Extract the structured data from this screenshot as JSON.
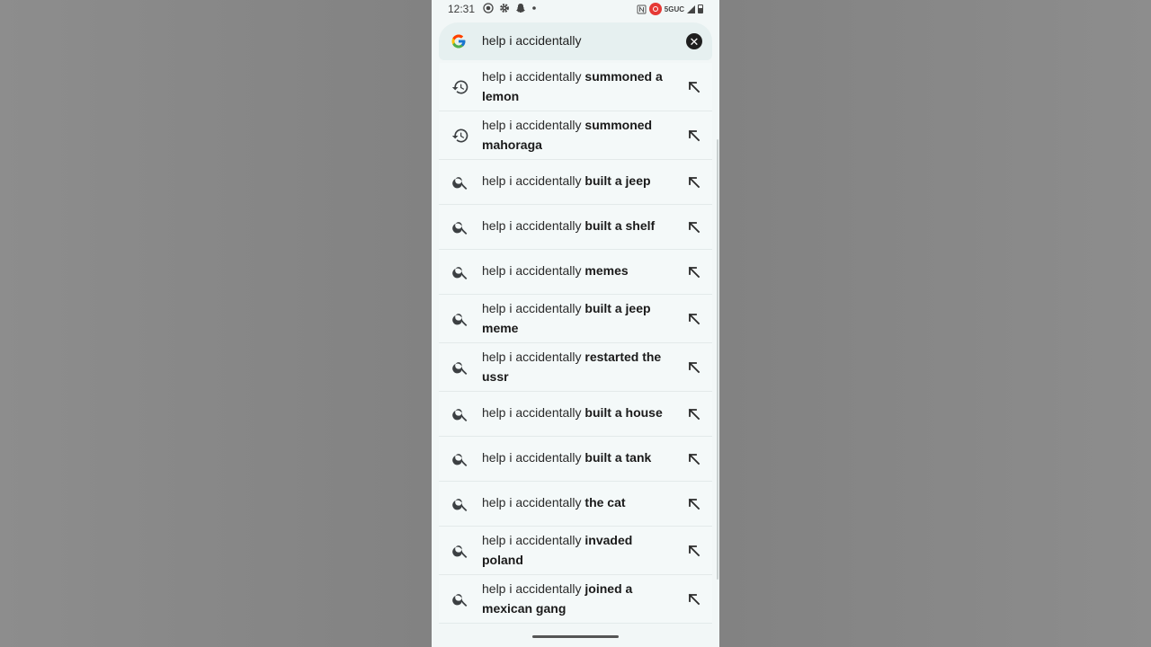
{
  "status_bar": {
    "time": "12:31",
    "left_icons": [
      "record-icon",
      "gear-icon",
      "snapchat-icon",
      "dot-icon"
    ],
    "network_label": "5GUC",
    "right_icons": [
      "nfc-icon",
      "screen-record-icon",
      "signal-icon",
      "battery-icon"
    ]
  },
  "search": {
    "query": "help i accidentally",
    "logo": "google-g-logo",
    "clear_icon": "close-circle-icon"
  },
  "suggestions": [
    {
      "type": "history",
      "prefix": "help i accidentally",
      "completion": "summoned a",
      "completion2": "lemon"
    },
    {
      "type": "history",
      "prefix": "help i accidentally",
      "completion": "summoned",
      "completion2": "mahoraga"
    },
    {
      "type": "search",
      "prefix": "help i accidentally",
      "completion": "built a jeep",
      "completion2": ""
    },
    {
      "type": "search",
      "prefix": "help i accidentally",
      "completion": "built a shelf",
      "completion2": ""
    },
    {
      "type": "search",
      "prefix": "help i accidentally",
      "completion": "memes",
      "completion2": ""
    },
    {
      "type": "search",
      "prefix": "help i accidentally",
      "completion": "built a jeep",
      "completion2": "meme"
    },
    {
      "type": "search",
      "prefix": "help i accidentally",
      "completion": "restarted the",
      "completion2": "ussr"
    },
    {
      "type": "search",
      "prefix": "help i accidentally",
      "completion": "built a house",
      "completion2": ""
    },
    {
      "type": "search",
      "prefix": "help i accidentally",
      "completion": "built a tank",
      "completion2": ""
    },
    {
      "type": "search",
      "prefix": "help i accidentally",
      "completion": "the cat",
      "completion2": ""
    },
    {
      "type": "search",
      "prefix": "help i accidentally",
      "completion": "invaded",
      "completion2": "poland"
    },
    {
      "type": "search",
      "prefix": "help i accidentally",
      "completion": "joined a",
      "completion2": "mexican gang"
    }
  ],
  "colors": {
    "background": "#858585",
    "phone_bg": "#f2f7f7",
    "search_bg": "#e6f0f0",
    "text": "#1f1f1f"
  }
}
